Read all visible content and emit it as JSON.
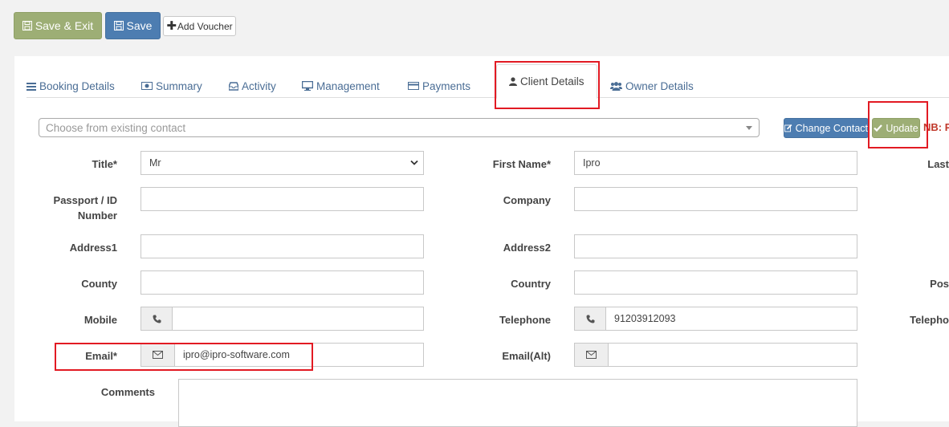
{
  "toolbar": {
    "save_exit_label": "Save & Exit",
    "save_label": "Save",
    "add_voucher_label": "Add Voucher"
  },
  "tabs": [
    {
      "label": "Booking Details",
      "icon": "list-icon"
    },
    {
      "label": "Summary",
      "icon": "money-icon"
    },
    {
      "label": "Activity",
      "icon": "inbox-icon"
    },
    {
      "label": "Management",
      "icon": "desktop-icon"
    },
    {
      "label": "Payments",
      "icon": "credit-card-icon"
    },
    {
      "label": "Client Details",
      "icon": "user-icon",
      "active": true
    },
    {
      "label": "Owner Details",
      "icon": "users-icon"
    }
  ],
  "contact_select": {
    "placeholder": "Choose from existing contact"
  },
  "actions": {
    "change_contact_label": "Change Contact",
    "update_label": "Update",
    "nb_text": "NB: P"
  },
  "form": {
    "title_label": "Title*",
    "title_value": "Mr",
    "first_name_label": "First Name*",
    "first_name_value": "Ipro",
    "last_name_label": "Last",
    "passport_label": "Passport / ID Number",
    "passport_value": "",
    "company_label": "Company",
    "company_value": "",
    "address1_label": "Address1",
    "address1_value": "",
    "address2_label": "Address2",
    "address2_value": "",
    "county_label": "County",
    "county_value": "",
    "country_label": "Country",
    "country_value": "",
    "postcode_label": "Pos",
    "mobile_label": "Mobile",
    "mobile_value": "",
    "telephone_label": "Telephone",
    "telephone_value": "91203912093",
    "telephone2_label": "Telepho",
    "email_label": "Email*",
    "email_value": "ipro@ipro-software.com",
    "email_alt_label": "Email(Alt)",
    "email_alt_value": "",
    "comments_label": "Comments",
    "comments_value": ""
  },
  "colors": {
    "save_green": "#9dae75",
    "primary_blue": "#4d7db1",
    "tab_link": "#4a6d95",
    "highlight_red": "#e21a23",
    "nb_red": "#c0392b"
  }
}
